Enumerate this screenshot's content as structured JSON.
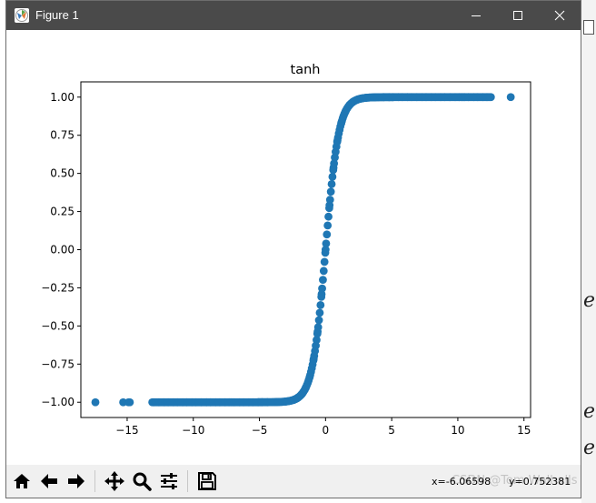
{
  "window": {
    "title": "Figure 1",
    "minimize_icon": "minimize-icon",
    "maximize_icon": "maximize-icon",
    "close_icon": "close-icon"
  },
  "toolbar": {
    "buttons": [
      "home-icon",
      "back-arrow-icon",
      "forward-arrow-icon",
      "pan-icon",
      "zoom-icon",
      "configure-subplots-icon",
      "save-icon"
    ],
    "coords_x": "x=-6.06598",
    "coords_y": "y=0.752381"
  },
  "watermark": "CSDN @Tom Walhalls",
  "chart_data": {
    "type": "scatter",
    "title": "tanh",
    "xlabel": "",
    "ylabel": "",
    "xlim": [
      -18.5,
      15.5
    ],
    "ylim": [
      -1.1,
      1.1
    ],
    "xticks": [
      -15,
      -10,
      -5,
      0,
      5,
      10,
      15
    ],
    "xtick_labels": [
      "−15",
      "−10",
      "−5",
      "0",
      "5",
      "10",
      "15"
    ],
    "yticks": [
      -1.0,
      -0.75,
      -0.5,
      -0.25,
      0.0,
      0.25,
      0.5,
      0.75,
      1.0
    ],
    "ytick_labels": [
      "−1.00",
      "−0.75",
      "−0.50",
      "−0.25",
      "0.00",
      "0.25",
      "0.50",
      "0.75",
      "1.00"
    ],
    "function": "tanh",
    "x_range": [
      -17.4,
      14.0
    ],
    "color": "#1f77b4",
    "grid": false,
    "series": [
      {
        "x": [
          -17.4,
          -15.3,
          -14.9,
          -14.8,
          -13.0,
          -12.6,
          -12.2,
          -11.9,
          -11.5,
          -11.2,
          -10.8,
          -10.5,
          -10.1,
          -9.8,
          -9.4,
          -9.0,
          -8.7,
          -8.3,
          -8.0,
          -7.6,
          -7.3,
          -6.9,
          -6.5,
          -6.2,
          -5.8,
          -5.5,
          -5.1,
          -4.8,
          -4.4,
          -4.0,
          -3.7,
          -3.3,
          -3.0,
          -2.7,
          -2.4,
          -2.1,
          -1.8,
          -1.5,
          -1.2,
          -0.9,
          -0.6,
          -0.3,
          0.0,
          0.3,
          0.6,
          0.9,
          1.2,
          1.5,
          1.8,
          2.1,
          2.4,
          2.7,
          3.0,
          3.3,
          3.7,
          4.0,
          4.4,
          4.8,
          5.1,
          5.5,
          5.8,
          6.2,
          6.5,
          6.9,
          7.3,
          7.6,
          8.0,
          8.3,
          8.7,
          9.0,
          9.4,
          9.8,
          10.1,
          10.5,
          10.8,
          11.2,
          11.5,
          11.9,
          12.2,
          12.5,
          14.0
        ]
      }
    ]
  }
}
